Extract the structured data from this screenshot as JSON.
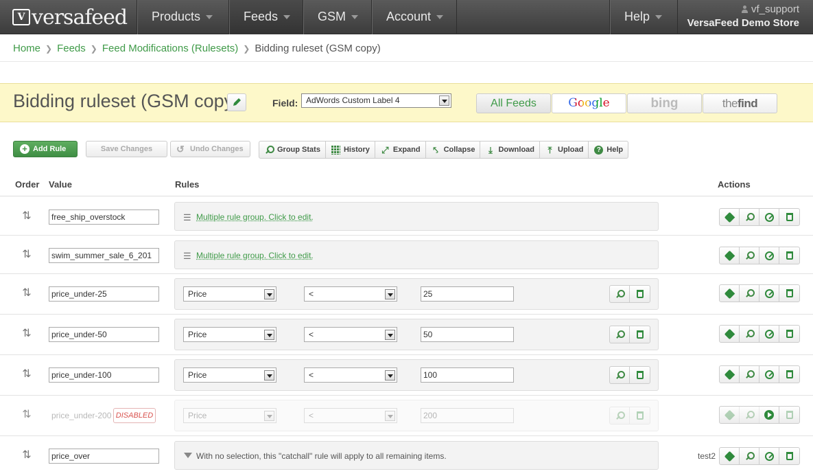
{
  "nav": {
    "logo": "versafeed",
    "items": [
      {
        "label": "Products"
      },
      {
        "label": "Feeds"
      },
      {
        "label": "GSM"
      },
      {
        "label": "Account"
      },
      {
        "label": "Help"
      }
    ],
    "user": "vf_support",
    "store": "VersaFeed Demo Store"
  },
  "breadcrumb": [
    "Home",
    "Feeds",
    "Feed Modifications (Rulesets)",
    "Bidding ruleset (GSM copy)"
  ],
  "title": "Bidding ruleset (GSM copy)",
  "field": {
    "label": "Field:",
    "value": "AdWords Custom Label 4"
  },
  "feeds": {
    "all": "All Feeds",
    "google": "Google",
    "bing": "bing",
    "thefind_the": "the",
    "thefind_find": "find"
  },
  "toolbar": {
    "add_rule": "Add Rule",
    "save_changes": "Save Changes",
    "undo_changes": "Undo Changes",
    "group": [
      "Group Stats",
      "History",
      "Expand",
      "Collapse",
      "Download",
      "Upload",
      "Help"
    ]
  },
  "columns": {
    "order": "Order",
    "value": "Value",
    "rules": "Rules",
    "actions": "Actions"
  },
  "rows": [
    {
      "value": "free_ship_overstock",
      "type": "group",
      "text": "Multiple rule group. Click to edit."
    },
    {
      "value": "swim_summer_sale_6_201",
      "type": "group",
      "text": "Multiple rule group. Click to edit."
    },
    {
      "value": "price_under-25",
      "type": "rule",
      "field": "Price",
      "op": "<",
      "amount": "25"
    },
    {
      "value": "price_under-50",
      "type": "rule",
      "field": "Price",
      "op": "<",
      "amount": "50"
    },
    {
      "value": "price_under-100",
      "type": "rule",
      "field": "Price",
      "op": "<",
      "amount": "100"
    },
    {
      "value": "price_under-200",
      "type": "rule",
      "field": "Price",
      "op": "<",
      "amount": "200",
      "badge": "DISABLED"
    },
    {
      "value": "price_over",
      "type": "catchall",
      "text": "With no selection, this \"catchall\" rule will apply to all remaining items.",
      "note": "test2"
    }
  ]
}
